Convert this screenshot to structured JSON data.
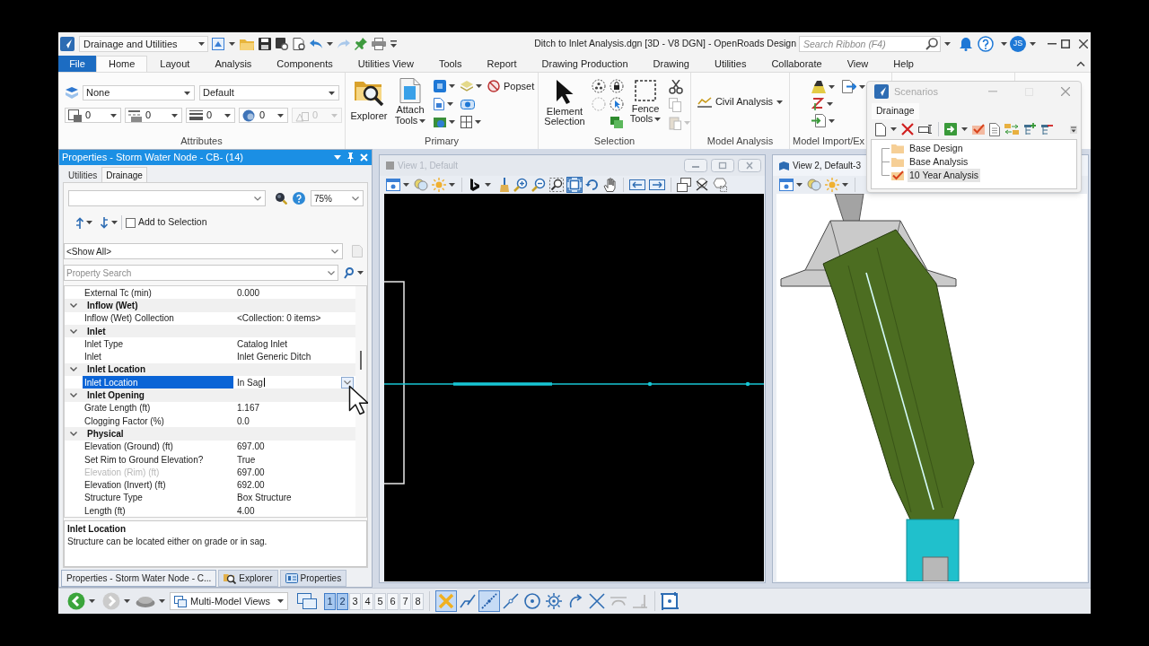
{
  "title_bar": {
    "workflow": "Drainage and Utilities",
    "title": "Ditch to Inlet Analysis.dgn [3D - V8 DGN] - OpenRoads Design",
    "search": {
      "placeholder": "Search Ribbon (F4)"
    },
    "user_initials": "JS"
  },
  "ribbon": {
    "file_tab": "File",
    "tabs": [
      {
        "label": "Home",
        "selected": true
      },
      {
        "label": "Layout",
        "selected": false
      },
      {
        "label": "Analysis",
        "selected": false
      },
      {
        "label": "Components",
        "selected": false
      },
      {
        "label": "Utilities View",
        "selected": false
      },
      {
        "label": "Tools",
        "selected": false
      },
      {
        "label": "Report",
        "selected": false
      },
      {
        "label": "Drawing Production",
        "selected": false
      },
      {
        "label": "Drawing",
        "selected": false
      },
      {
        "label": "Utilities",
        "selected": false
      },
      {
        "label": "Collaborate",
        "selected": false
      },
      {
        "label": "View",
        "selected": false
      },
      {
        "label": "Help",
        "selected": false
      }
    ],
    "groups": {
      "attributes": {
        "label": "Attributes",
        "level": "None",
        "style": "Default",
        "settings": [
          {
            "value": "0",
            "disabled": false
          },
          {
            "value": "0",
            "disabled": false
          },
          {
            "value": "0",
            "disabled": false
          },
          {
            "value": "0",
            "disabled": false
          },
          {
            "value": "0",
            "disabled": true
          }
        ]
      },
      "primary": {
        "label": "Primary",
        "explorer": "Explorer",
        "attach_tools": "Attach Tools",
        "popset": "Popset"
      },
      "selection": {
        "label": "Selection",
        "element_selection": "Element Selection",
        "fence_tools": "Fence Tools"
      },
      "model_analysis": {
        "label": "Model Analysis",
        "civil_analysis": "Civil Analysis"
      },
      "model_import": {
        "label": "Model Import/Ex"
      }
    }
  },
  "properties_panel": {
    "title": "Properties - Storm Water Node - CB- (14)",
    "tabs": [
      {
        "label": "Utilities",
        "selected": false
      },
      {
        "label": "Drainage",
        "selected": true
      }
    ],
    "zoom": "75%",
    "add_to_selection": {
      "label": "Add to Selection",
      "checked": false
    },
    "filter": "<Show All>",
    "search": {
      "placeholder": "Property Search"
    },
    "rows": [
      {
        "kind": "property",
        "name": "External Tc (min)",
        "value": "0.000",
        "selected": false,
        "disabled": false
      },
      {
        "kind": "category",
        "name": "Inflow (Wet)",
        "expanded": true
      },
      {
        "kind": "property",
        "name": "Inflow (Wet) Collection",
        "value": "<Collection: 0 items>",
        "selected": false,
        "disabled": false
      },
      {
        "kind": "category",
        "name": "Inlet",
        "expanded": true
      },
      {
        "kind": "property",
        "name": "Inlet Type",
        "value": "Catalog Inlet",
        "selected": false,
        "disabled": false
      },
      {
        "kind": "property",
        "name": "Inlet",
        "value": "Inlet Generic Ditch",
        "selected": false,
        "disabled": false
      },
      {
        "kind": "category",
        "name": "Inlet Location",
        "expanded": true
      },
      {
        "kind": "property",
        "name": "Inlet Location",
        "value": "In Sag",
        "selected": true,
        "disabled": false
      },
      {
        "kind": "category",
        "name": "Inlet Opening",
        "expanded": true
      },
      {
        "kind": "property",
        "name": "Grate Length (ft)",
        "value": "1.167",
        "selected": false,
        "disabled": false
      },
      {
        "kind": "property",
        "name": "Clogging Factor (%)",
        "value": "0.0",
        "selected": false,
        "disabled": false
      },
      {
        "kind": "category",
        "name": "Physical",
        "expanded": true
      },
      {
        "kind": "property",
        "name": "Elevation (Ground) (ft)",
        "value": "697.00",
        "selected": false,
        "disabled": false
      },
      {
        "kind": "property",
        "name": "Set Rim to Ground Elevation?",
        "value": "True",
        "selected": false,
        "disabled": false
      },
      {
        "kind": "property",
        "name": "Elevation (Rim) (ft)",
        "value": "697.00",
        "selected": false,
        "disabled": true
      },
      {
        "kind": "property",
        "name": "Elevation (Invert) (ft)",
        "value": "692.00",
        "selected": false,
        "disabled": false
      },
      {
        "kind": "property",
        "name": "Structure Type",
        "value": "Box Structure",
        "selected": false,
        "disabled": false
      },
      {
        "kind": "property",
        "name": "Length (ft)",
        "value": "4.00",
        "selected": false,
        "disabled": false
      }
    ],
    "description": {
      "title": "Inlet Location",
      "text": "Structure can be located either on grade or in sag."
    },
    "bottom_tabs": [
      {
        "label": "Properties - Storm Water Node - C...",
        "kind": "document",
        "selected": true
      },
      {
        "label": "Explorer",
        "kind": "explorer",
        "selected": false
      },
      {
        "label": "Properties",
        "kind": "properties",
        "selected": false
      }
    ]
  },
  "views": [
    {
      "title": "View 1, Default",
      "kind": "plan",
      "active": false,
      "tools": [
        {
          "selected": false
        },
        {
          "selected": false
        },
        {
          "selected": false
        },
        {
          "selected": false
        },
        {
          "selected": false
        },
        {
          "selected": false
        },
        {
          "selected": false
        },
        {
          "selected": false
        },
        {
          "selected": true
        },
        {
          "selected": false
        },
        {
          "selected": false
        },
        {
          "selected": false
        },
        {
          "selected": false
        },
        {
          "selected": false
        },
        {
          "selected": false
        },
        {
          "selected": false
        }
      ]
    },
    {
      "title": "View 2, Default-3",
      "kind": "perspective",
      "active": true,
      "tools": [
        {
          "selected": false
        },
        {
          "selected": false
        },
        {
          "selected": false
        }
      ]
    }
  ],
  "scenarios": {
    "title": "Scenarios",
    "tab": "Drainage",
    "items": [
      {
        "label": "Base Design",
        "active": false
      },
      {
        "label": "Base Analysis",
        "active": false
      },
      {
        "label": "10 Year Analysis",
        "active": true
      }
    ]
  },
  "bottom_toolbar": {
    "model_views": "Multi-Model Views",
    "view_numbers": [
      {
        "label": "1",
        "selected": true
      },
      {
        "label": "2",
        "selected": true
      },
      {
        "label": "3",
        "selected": false
      },
      {
        "label": "4",
        "selected": false
      },
      {
        "label": "5",
        "selected": false
      },
      {
        "label": "6",
        "selected": false
      },
      {
        "label": "7",
        "selected": false
      },
      {
        "label": "8",
        "selected": false
      }
    ],
    "tools": [
      {
        "selected": true
      },
      {
        "selected": false
      },
      {
        "selected": true
      },
      {
        "selected": false
      },
      {
        "selected": false
      },
      {
        "selected": false
      },
      {
        "selected": false
      },
      {
        "selected": false
      },
      {
        "selected": false
      },
      {
        "selected": false
      },
      {
        "selected": false
      }
    ]
  }
}
